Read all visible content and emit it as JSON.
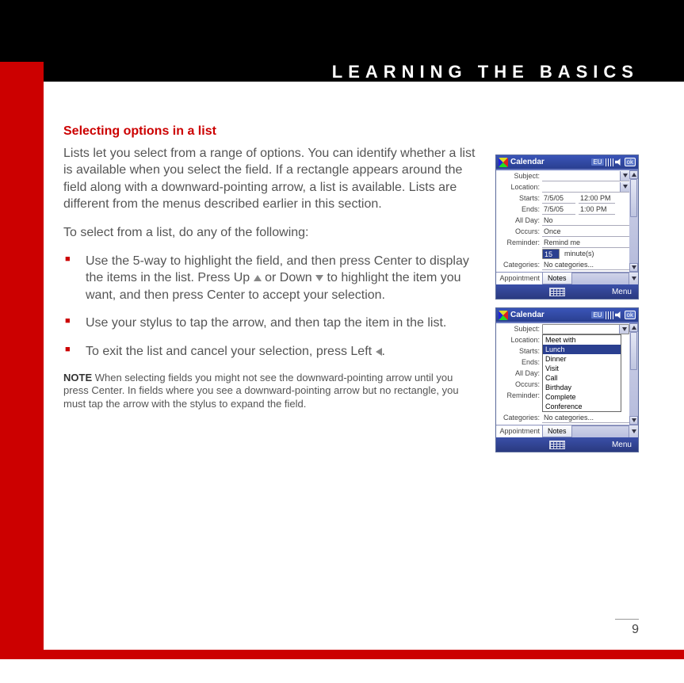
{
  "header": {
    "chapter_title": "LEARNING  THE  BASICS"
  },
  "section": {
    "heading": "Selecting options in a list",
    "intro": "Lists let you select from a range of options. You can identify whether a list is available when you select the field. If a rectangle appears around the field along with a downward-pointing arrow, a list is available. Lists are different from the menus described earlier in this section.",
    "list_intro": "To select from a list, do any of the following:",
    "bullets": {
      "b1a": "Use the 5-way to highlight the field, and then press Center to display the items in the list. Press Up ",
      "b1b": " or Down ",
      "b1c": " to highlight the item you want, and then press Center to accept your selection.",
      "b2": "Use your stylus to tap the arrow, and then tap the item in the list.",
      "b3a": "To exit the list and cancel your selection, press Left ",
      "b3b": "."
    },
    "note_label": "NOTE",
    "note": " When selecting fields you might not see the downward-pointing arrow until you press Center. In fields where you see a downward-pointing arrow but no rectangle, you must tap the arrow with the stylus to expand the field."
  },
  "pda_common": {
    "app_title": "Calendar",
    "eu_badge": "EU",
    "ok": "ok",
    "menu": "Menu",
    "tab_notes": "Notes",
    "labels": {
      "subject": "Subject:",
      "location": "Location:",
      "starts": "Starts:",
      "ends": "Ends:",
      "allday": "All Day:",
      "occurs": "Occurs:",
      "reminder": "Reminder:",
      "categories": "Categories:",
      "appointment": "Appointment"
    }
  },
  "pda1": {
    "starts_date": "7/5/05",
    "starts_time": "12:00 PM",
    "ends_date": "7/5/05",
    "ends_time": "1:00 PM",
    "allday": "No",
    "occurs": "Once",
    "reminder": "Remind me",
    "reminder_num": "15",
    "reminder_unit": "minute(s)",
    "categories": "No categories..."
  },
  "pda2": {
    "categories": "No categories...",
    "popup": [
      "Meet with",
      "Lunch",
      "Dinner",
      "Visit",
      "Call",
      "Birthday",
      "Complete",
      "Conference"
    ]
  },
  "page_number": "9"
}
